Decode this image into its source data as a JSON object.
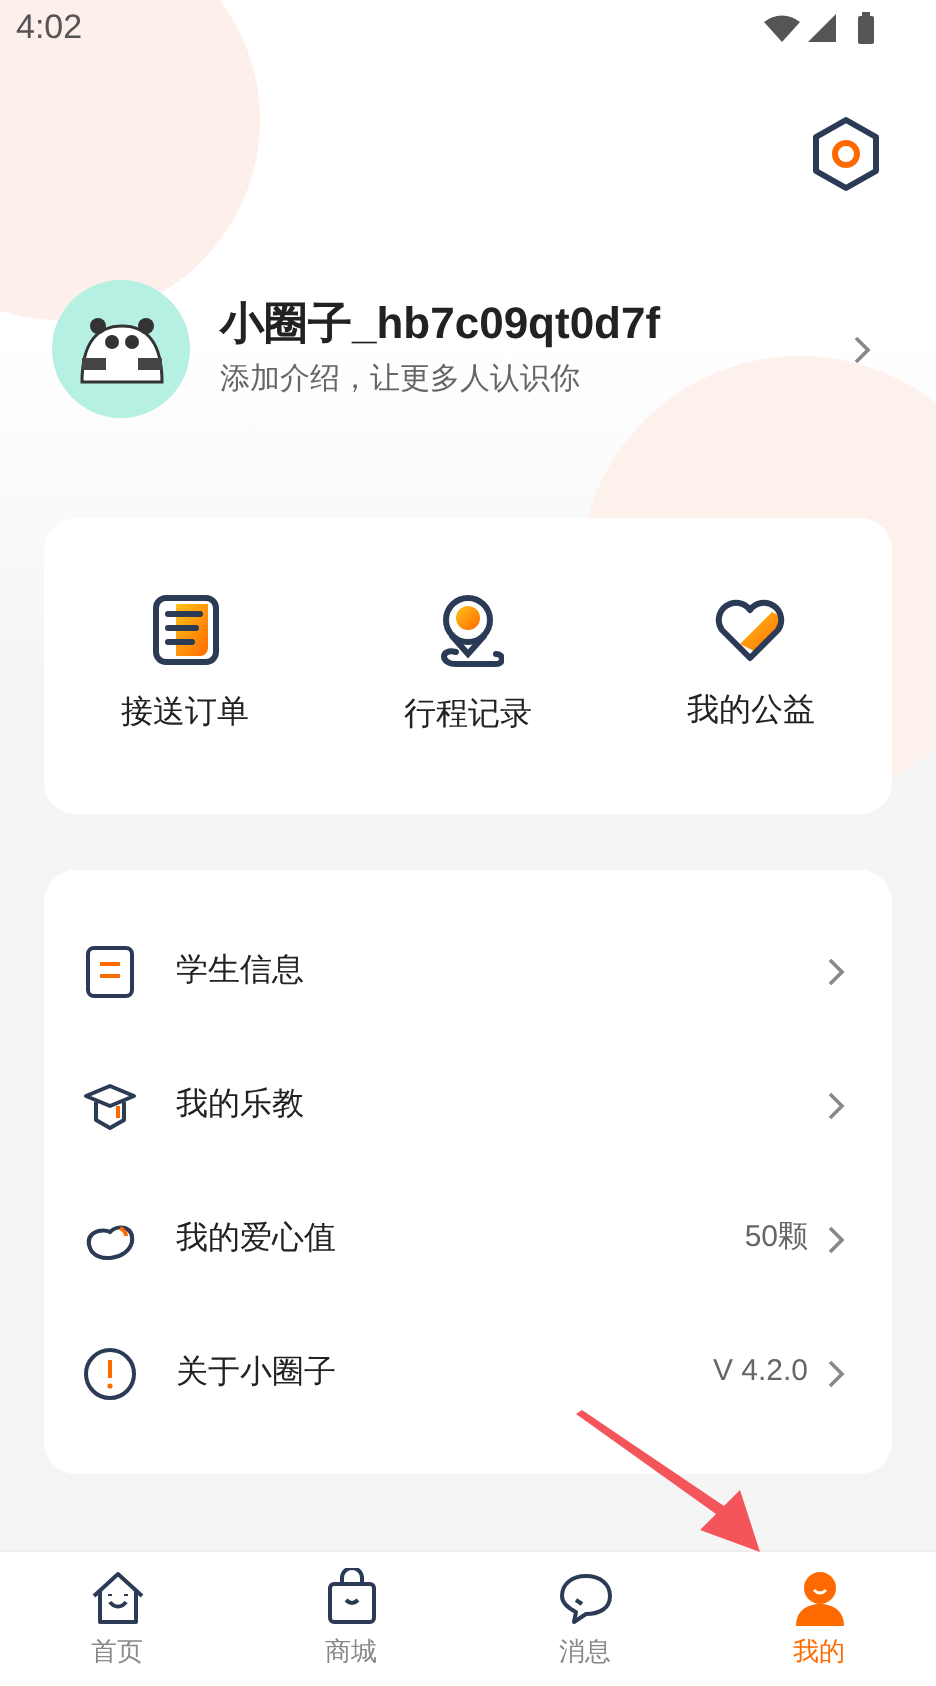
{
  "status_bar": {
    "time": "4:02"
  },
  "profile": {
    "name": "小圈子_hb7c09qt0d7f",
    "bio": "添加介绍，让更多人认识你"
  },
  "shortcuts": [
    {
      "label": "接送订单"
    },
    {
      "label": "行程记录"
    },
    {
      "label": "我的公益"
    }
  ],
  "menu": [
    {
      "label": "学生信息"
    },
    {
      "label": "我的乐教"
    },
    {
      "label": "我的爱心值",
      "value": "50颗"
    },
    {
      "label": "关于小圈子",
      "value": "V 4.2.0"
    }
  ],
  "tab_bar": [
    {
      "label": "首页",
      "selected": false
    },
    {
      "label": "商城",
      "selected": false
    },
    {
      "label": "消息",
      "selected": false
    },
    {
      "label": "我的",
      "selected": true
    }
  ]
}
